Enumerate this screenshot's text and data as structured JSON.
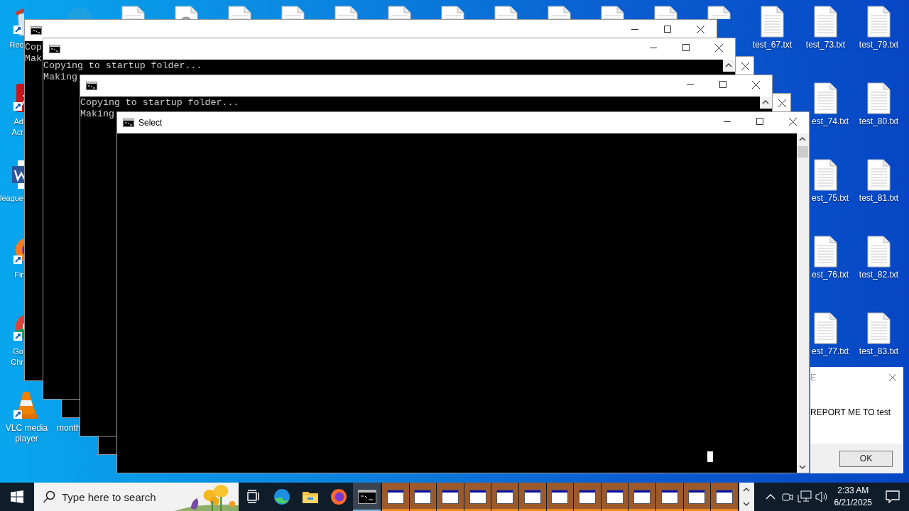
{
  "desktop_icons": [
    {
      "kind": "recycle_bin",
      "label": "Rec"
    },
    {
      "kind": "acrobat",
      "label": "Ad\nAcr"
    },
    {
      "kind": "word",
      "label": "league"
    },
    {
      "kind": "firefox",
      "label": "Fir"
    },
    {
      "kind": "chrome",
      "label": "Go\nChr"
    },
    {
      "kind": "vlc",
      "label": "VLC media\nplayer"
    },
    {
      "kind": "edge"
    },
    {
      "label": "month"
    },
    {
      "kind": "text_file"
    },
    {
      "kind": "settings_file"
    },
    {
      "kind": "text_file"
    },
    {
      "kind": "text_file"
    },
    {
      "kind": "text_file"
    },
    {
      "kind": "text_file"
    },
    {
      "kind": "text_file"
    },
    {
      "kind": "text_file"
    },
    {
      "kind": "text_file"
    },
    {
      "kind": "text_file"
    },
    {
      "kind": "text_file"
    },
    {
      "kind": "text_file"
    },
    {
      "kind": "text_file",
      "label": "test_67.txt"
    },
    {
      "kind": "text_file",
      "label": "test_73.txt"
    },
    {
      "kind": "text_file",
      "label": "est_74.txt"
    },
    {
      "kind": "text_file",
      "label": "est_75.txt"
    },
    {
      "kind": "text_file",
      "label": "est_76.txt"
    },
    {
      "kind": "text_file",
      "label": "est_77.txt"
    },
    {
      "kind": "text_file",
      "label": "test_79.txt"
    },
    {
      "kind": "text_file",
      "label": "test_80.txt"
    },
    {
      "kind": "text_file",
      "label": "test_81.txt"
    },
    {
      "kind": "text_file",
      "label": "test_82.txt"
    },
    {
      "kind": "text_file",
      "label": "test_83.txt"
    }
  ],
  "windows": [
    {
      "kind": "console",
      "lines": [
        "Cop",
        "Mak"
      ]
    },
    {
      "kind": "console",
      "lines": [
        "Copying to startup folder...",
        "Making"
      ]
    },
    {
      "kind": "console_behind"
    },
    {
      "kind": "console",
      "lines": [
        "Copying to startup folder...",
        "Making"
      ]
    },
    {
      "kind": "console_behind"
    },
    {
      "kind": "console",
      "title": "Select",
      "cursor_visible": true
    }
  ],
  "message_box": {
    "title": "E",
    "message": "REPORT ME TO test",
    "button": "OK"
  },
  "taskbar": {
    "search": {
      "placeholder": "Type here to search"
    },
    "apps": [
      {
        "kind": "task_view",
        "selected": false
      },
      {
        "kind": "edge",
        "selected": false
      },
      {
        "kind": "explorer",
        "selected": false
      },
      {
        "kind": "firefox",
        "selected": false
      },
      {
        "kind": "console",
        "selected": true
      }
    ],
    "window_buttons": [
      {
        "selected": false
      },
      {
        "selected": false
      },
      {
        "selected": false
      },
      {
        "selected": false
      },
      {
        "selected": false
      },
      {
        "selected": false
      },
      {
        "selected": false
      },
      {
        "selected": false
      },
      {
        "selected": false
      },
      {
        "selected": false
      },
      {
        "selected": false
      },
      {
        "selected": false
      },
      {
        "selected": false
      }
    ],
    "time": "2:33 AM",
    "date": "6/21/2025"
  }
}
